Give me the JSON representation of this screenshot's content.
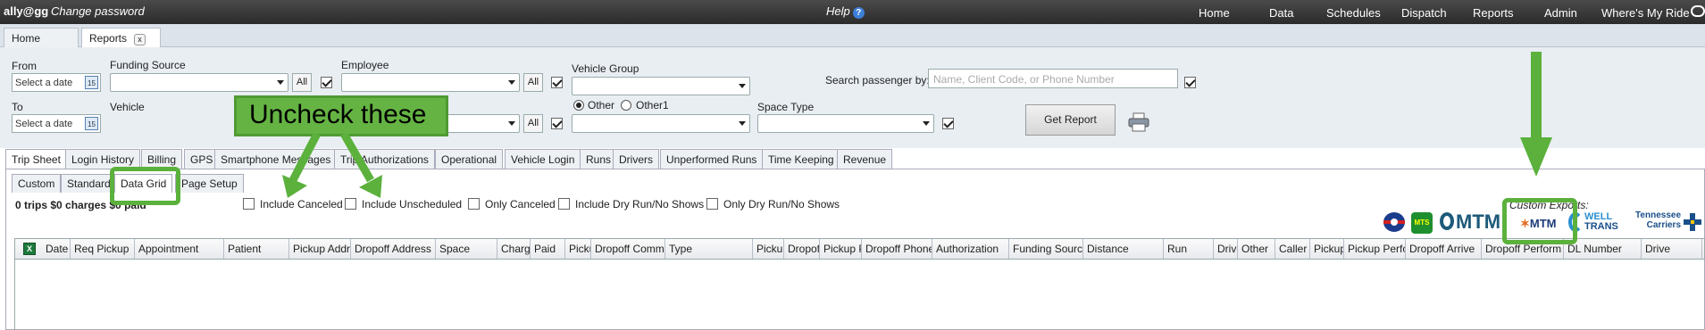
{
  "topbar": {
    "user": "ally@gg",
    "change_password": "Change password",
    "help": "Help",
    "nav": [
      "Home",
      "Data",
      "Schedules",
      "Dispatch",
      "Reports",
      "Admin",
      "Where's My Ride"
    ]
  },
  "top_tabs": [
    "Home",
    "Reports"
  ],
  "filters": {
    "from_label": "From",
    "to_label": "To",
    "date_placeholder": "Select a date",
    "calendar_day": "15",
    "funding_source_label": "Funding Source",
    "employee_label": "Employee",
    "vehicle_label": "Vehicle",
    "vehicle_group_label": "Vehicle Group",
    "all_label": "All",
    "other_label": "Other",
    "other1_label": "Other1",
    "space_type_label": "Space Type",
    "search_label": "Search passenger by:",
    "search_placeholder": "Name, Client Code, or Phone Number",
    "get_report": "Get Report"
  },
  "report_tabs": [
    "Trip Sheet",
    "Login History",
    "Billing",
    "GPS",
    "Smartphone Messages",
    "Trip Authorizations",
    "Operational",
    "Vehicle Login",
    "Runs",
    "Drivers",
    "Unperformed Runs",
    "Time Keeping",
    "Revenue"
  ],
  "sub_tabs": [
    "Custom",
    "Standard",
    "Data Grid",
    "Page Setup"
  ],
  "summary": "0 trips $0 charges $0 paid",
  "options": [
    "Include Canceled",
    "Include Unscheduled",
    "Only Canceled",
    "Include Dry Run/No Shows",
    "Only Dry Run/No Shows"
  ],
  "custom_exports_label": "Custom Exports:",
  "logos": {
    "mts": "MTS",
    "mtm": "MTM",
    "mtm_small": "MTM",
    "well": "WELL",
    "trans": "TRANS",
    "tn1": "Tennessee",
    "tn2": "Carriers"
  },
  "columns": [
    "Date",
    "Req Pickup",
    "Appointment",
    "Patient",
    "Pickup Address",
    "Dropoff Address",
    "Space",
    "Charge",
    "Paid",
    "Pickup Comment",
    "Dropoff Comment",
    "Type",
    "Pickup",
    "Dropoff",
    "Pickup Phone",
    "Dropoff Phone",
    "Authorization",
    "Funding Source",
    "Distance",
    "Run",
    "Driver",
    "Other",
    "Caller",
    "Pickup Arrive",
    "Pickup Perform",
    "Dropoff Arrive",
    "Dropoff Perform",
    "DL Number",
    "Drive"
  ],
  "annotation": "Uncheck these",
  "colors": {
    "topbar": "#333333",
    "annotation_green": "#65b443",
    "filter_bg": "#e9eef3"
  }
}
